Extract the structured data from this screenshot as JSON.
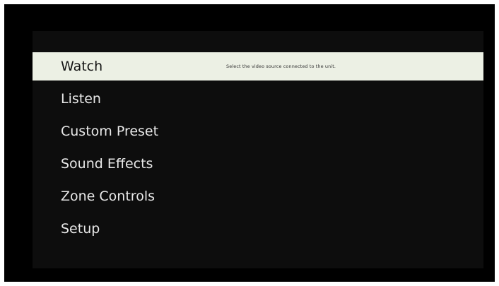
{
  "menu": {
    "items": [
      {
        "label": "Watch",
        "selected": true,
        "description": "Select the video source connected to the unit."
      },
      {
        "label": "Listen",
        "selected": false
      },
      {
        "label": "Custom Preset",
        "selected": false
      },
      {
        "label": "Sound Effects",
        "selected": false
      },
      {
        "label": "Zone Controls",
        "selected": false
      },
      {
        "label": "Setup",
        "selected": false
      }
    ]
  },
  "colors": {
    "background": "#000000",
    "panel": "#0d0d0d",
    "highlight": "#ecf0e4",
    "text": "#e8e8e8",
    "highlight_text": "#141414"
  }
}
